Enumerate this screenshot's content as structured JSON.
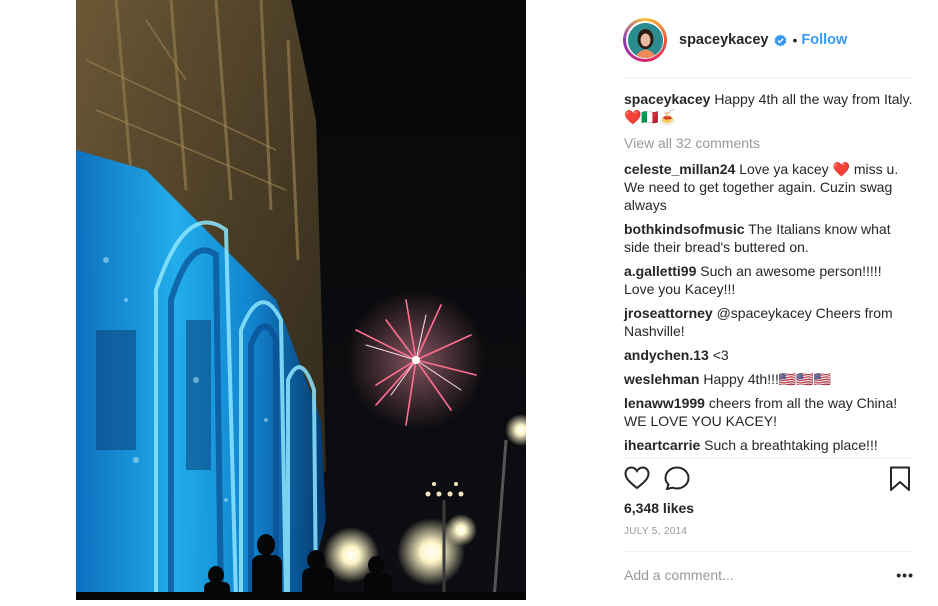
{
  "post": {
    "username": "spaceykacey",
    "follow_label": "Follow",
    "separator": "•",
    "caption": {
      "username": "spaceykacey",
      "text": "Happy 4th all the way from Italy. ❤️🇮🇹🍝"
    },
    "view_all_label": "View all 32 comments",
    "comments": [
      {
        "user": "celeste_millan24",
        "text": "Love ya kacey ❤️ miss u. We need to get together again. Cuzin swag always"
      },
      {
        "user": "bothkindsofmusic",
        "text": "The Italians know what side their bread's buttered on."
      },
      {
        "user": "a.galletti99",
        "text": "Such an awesome person!!!!! Love you Kacey!!!"
      },
      {
        "user": "jroseattorney",
        "text": "@spaceykacey Cheers from Nashville!"
      },
      {
        "user": "andychen.13",
        "text": "<3"
      },
      {
        "user": "weslehman",
        "text": "Happy 4th!!!🇺🇸🇺🇸🇺🇸"
      },
      {
        "user": "lenaww1999",
        "text": "cheers from all the way China! WE LOVE YOU KACEY!"
      },
      {
        "user": "iheartcarrie",
        "text": "Such a breathtaking place!!!"
      }
    ],
    "likes": "6,348 likes",
    "date": "JULY 5, 2014",
    "add_comment_placeholder": "Add a comment...",
    "more_label": "•••"
  },
  "icons": {
    "like": "heart-icon",
    "comment": "speech-bubble-icon",
    "save": "bookmark-icon",
    "verified": "verified-badge-icon"
  },
  "colors": {
    "accent": "#3897f0",
    "muted": "#999999",
    "text": "#262626",
    "divider": "#efefef"
  }
}
